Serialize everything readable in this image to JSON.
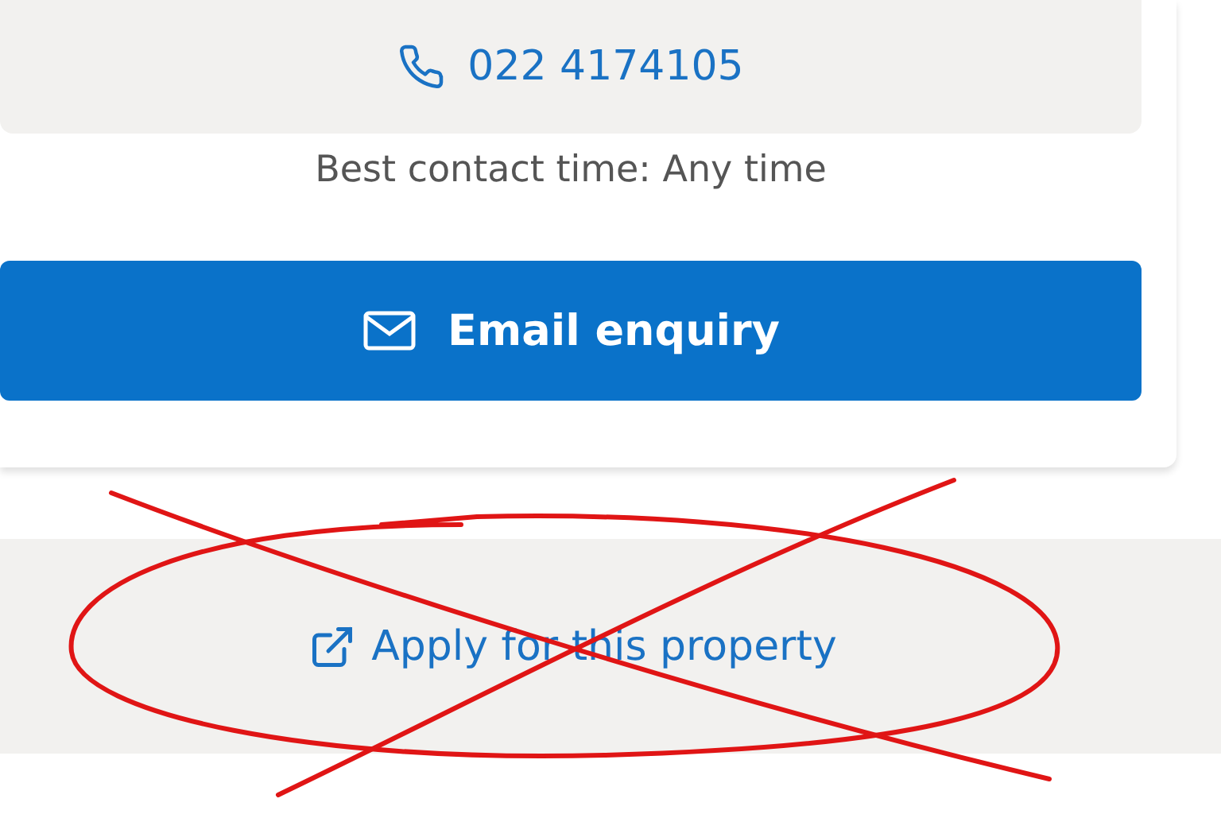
{
  "phone": {
    "number": "022 4174105"
  },
  "contact_time": "Best contact time: Any time",
  "buttons": [
    {
      "label": "Email enquiry",
      "kind": "email"
    }
  ],
  "apply_link": {
    "label": "Apply for this property"
  }
}
